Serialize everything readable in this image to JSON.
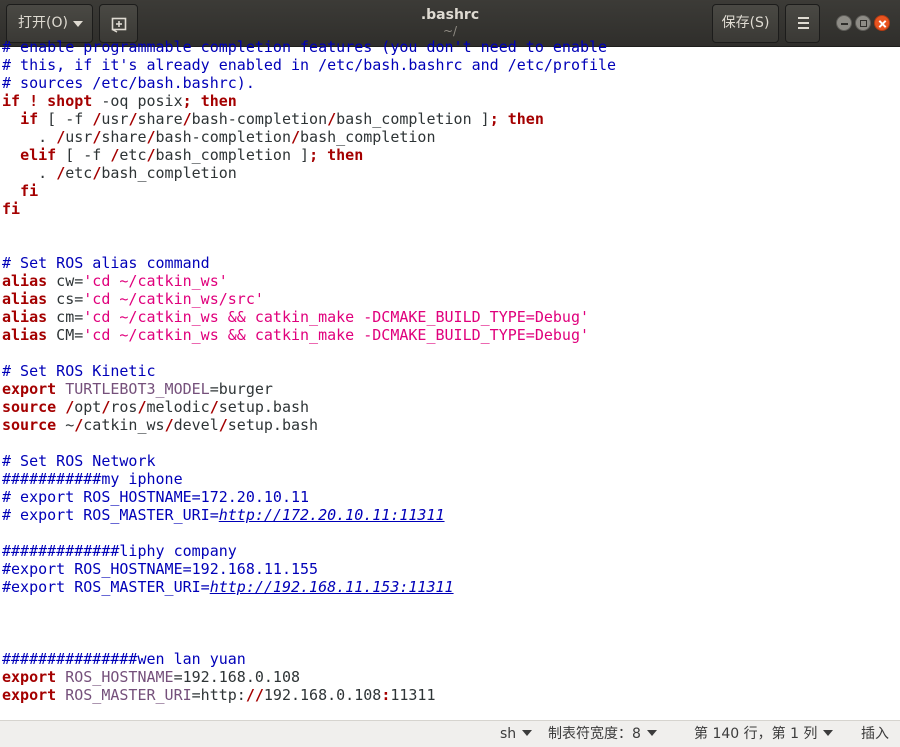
{
  "header": {
    "open_label": "打开(O)",
    "title": ".bashrc",
    "subtitle": "~/",
    "save_label": "保存(S)"
  },
  "editor": {
    "lines": [
      [
        [
          "c",
          "# enable programmable completion features (you don't need to enable"
        ]
      ],
      [
        [
          "c",
          "# this, if it's already enabled in /etc/bash.bashrc and /etc/profile"
        ]
      ],
      [
        [
          "c",
          "# sources /etc/bash.bashrc)."
        ]
      ],
      [
        [
          "k",
          "if"
        ],
        [
          "t",
          " "
        ],
        [
          "k",
          "!"
        ],
        [
          "t",
          " "
        ],
        [
          "k",
          "shopt"
        ],
        [
          "t",
          " -oq posix"
        ],
        [
          "k",
          ";"
        ],
        [
          "t",
          " "
        ],
        [
          "k",
          "then"
        ]
      ],
      [
        [
          "t",
          "  "
        ],
        [
          "k",
          "if"
        ],
        [
          "t",
          " [ -f "
        ],
        [
          "p",
          "/"
        ],
        [
          "t",
          "usr"
        ],
        [
          "p",
          "/"
        ],
        [
          "t",
          "share"
        ],
        [
          "p",
          "/"
        ],
        [
          "t",
          "bash-completion"
        ],
        [
          "p",
          "/"
        ],
        [
          "t",
          "bash_completion ]"
        ],
        [
          "k",
          ";"
        ],
        [
          "t",
          " "
        ],
        [
          "k",
          "then"
        ]
      ],
      [
        [
          "t",
          "    . "
        ],
        [
          "p",
          "/"
        ],
        [
          "t",
          "usr"
        ],
        [
          "p",
          "/"
        ],
        [
          "t",
          "share"
        ],
        [
          "p",
          "/"
        ],
        [
          "t",
          "bash-completion"
        ],
        [
          "p",
          "/"
        ],
        [
          "t",
          "bash_completion"
        ]
      ],
      [
        [
          "t",
          "  "
        ],
        [
          "k",
          "elif"
        ],
        [
          "t",
          " [ -f "
        ],
        [
          "p",
          "/"
        ],
        [
          "t",
          "etc"
        ],
        [
          "p",
          "/"
        ],
        [
          "t",
          "bash_completion ]"
        ],
        [
          "k",
          ";"
        ],
        [
          "t",
          " "
        ],
        [
          "k",
          "then"
        ]
      ],
      [
        [
          "t",
          "    . "
        ],
        [
          "p",
          "/"
        ],
        [
          "t",
          "etc"
        ],
        [
          "p",
          "/"
        ],
        [
          "t",
          "bash_completion"
        ]
      ],
      [
        [
          "t",
          "  "
        ],
        [
          "k",
          "fi"
        ]
      ],
      [
        [
          "k",
          "fi"
        ]
      ],
      [],
      [],
      [
        [
          "c",
          "# Set ROS alias command"
        ]
      ],
      [
        [
          "k",
          "alias"
        ],
        [
          "t",
          " cw="
        ],
        [
          "s",
          "'cd ~/catkin_ws'"
        ]
      ],
      [
        [
          "k",
          "alias"
        ],
        [
          "t",
          " cs="
        ],
        [
          "s",
          "'cd ~/catkin_ws/src'"
        ]
      ],
      [
        [
          "k",
          "alias"
        ],
        [
          "t",
          " cm="
        ],
        [
          "s",
          "'cd ~/catkin_ws && catkin_make -DCMAKE_BUILD_TYPE=Debug'"
        ]
      ],
      [
        [
          "k",
          "alias"
        ],
        [
          "t",
          " CM="
        ],
        [
          "s",
          "'cd ~/catkin_ws && catkin_make -DCMAKE_BUILD_TYPE=Debug'"
        ]
      ],
      [],
      [
        [
          "c",
          "# Set ROS Kinetic"
        ]
      ],
      [
        [
          "k",
          "export"
        ],
        [
          "t",
          " "
        ],
        [
          "v",
          "TURTLEBOT3_MODEL"
        ],
        [
          "t",
          "=burger"
        ]
      ],
      [
        [
          "k",
          "source"
        ],
        [
          "t",
          " "
        ],
        [
          "p",
          "/"
        ],
        [
          "t",
          "opt"
        ],
        [
          "p",
          "/"
        ],
        [
          "t",
          "ros"
        ],
        [
          "p",
          "/"
        ],
        [
          "t",
          "melodic"
        ],
        [
          "p",
          "/"
        ],
        [
          "t",
          "setup.bash"
        ]
      ],
      [
        [
          "k",
          "source"
        ],
        [
          "t",
          " ~"
        ],
        [
          "p",
          "/"
        ],
        [
          "t",
          "catkin_ws"
        ],
        [
          "p",
          "/"
        ],
        [
          "t",
          "devel"
        ],
        [
          "p",
          "/"
        ],
        [
          "t",
          "setup.bash"
        ]
      ],
      [],
      [
        [
          "c",
          "# Set ROS Network"
        ]
      ],
      [
        [
          "c",
          "###########my iphone"
        ]
      ],
      [
        [
          "c",
          "# export ROS_HOSTNAME=172.20.10.11"
        ]
      ],
      [
        [
          "c",
          "# export ROS_MASTER_URI="
        ],
        [
          "u",
          "http://172.20.10.11:11311"
        ]
      ],
      [],
      [
        [
          "c",
          "#############liphy company"
        ]
      ],
      [
        [
          "c",
          "#export ROS_HOSTNAME=192.168.11.155"
        ]
      ],
      [
        [
          "c",
          "#export ROS_MASTER_URI="
        ],
        [
          "u",
          "http://192.168.11.153:11311"
        ]
      ],
      [],
      [],
      [],
      [
        [
          "c",
          "###############wen lan yuan"
        ]
      ],
      [
        [
          "k",
          "export"
        ],
        [
          "t",
          " "
        ],
        [
          "v",
          "ROS_HOSTNAME"
        ],
        [
          "t",
          "=192.168.0.108"
        ]
      ],
      [
        [
          "k",
          "export"
        ],
        [
          "t",
          " "
        ],
        [
          "v",
          "ROS_MASTER_URI"
        ],
        [
          "t",
          "=http:"
        ],
        [
          "p",
          "//"
        ],
        [
          "t",
          "192.168.0.108"
        ],
        [
          "p",
          ":"
        ],
        [
          "t",
          "11311"
        ]
      ]
    ]
  },
  "status": {
    "language": "sh",
    "tab_width": "制表符宽度：8",
    "position": "第 140 行，第 1 列",
    "mode": "插入"
  }
}
